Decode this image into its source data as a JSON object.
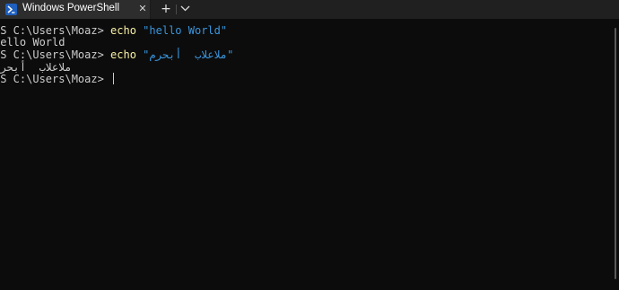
{
  "window": {
    "tab_title": "Windows PowerShell",
    "close_glyph": "✕",
    "new_tab_glyph": "+",
    "icons": {
      "tab": "powershell-icon",
      "close": "close-icon",
      "new_tab": "plus-icon",
      "dropdown": "chevron-down-icon"
    }
  },
  "terminal": {
    "colors": {
      "background": "#0c0c0c",
      "text": "#cccccc",
      "command": "#f9f1a5",
      "string": "#3a96dd"
    },
    "lines": [
      {
        "prompt": "PS C:\\Users\\Moaz> ",
        "command": "echo",
        "argument": " \"hello World\""
      },
      {
        "output": "hello World"
      },
      {
        "prompt": "PS C:\\Users\\Moaz> ",
        "command": "echo",
        "argument": " \"ملاعلاب  أبحرم\""
      },
      {
        "output": "ملاعلاب  أبحرم"
      },
      {
        "prompt": "PS C:\\Users\\Moaz> "
      }
    ]
  }
}
